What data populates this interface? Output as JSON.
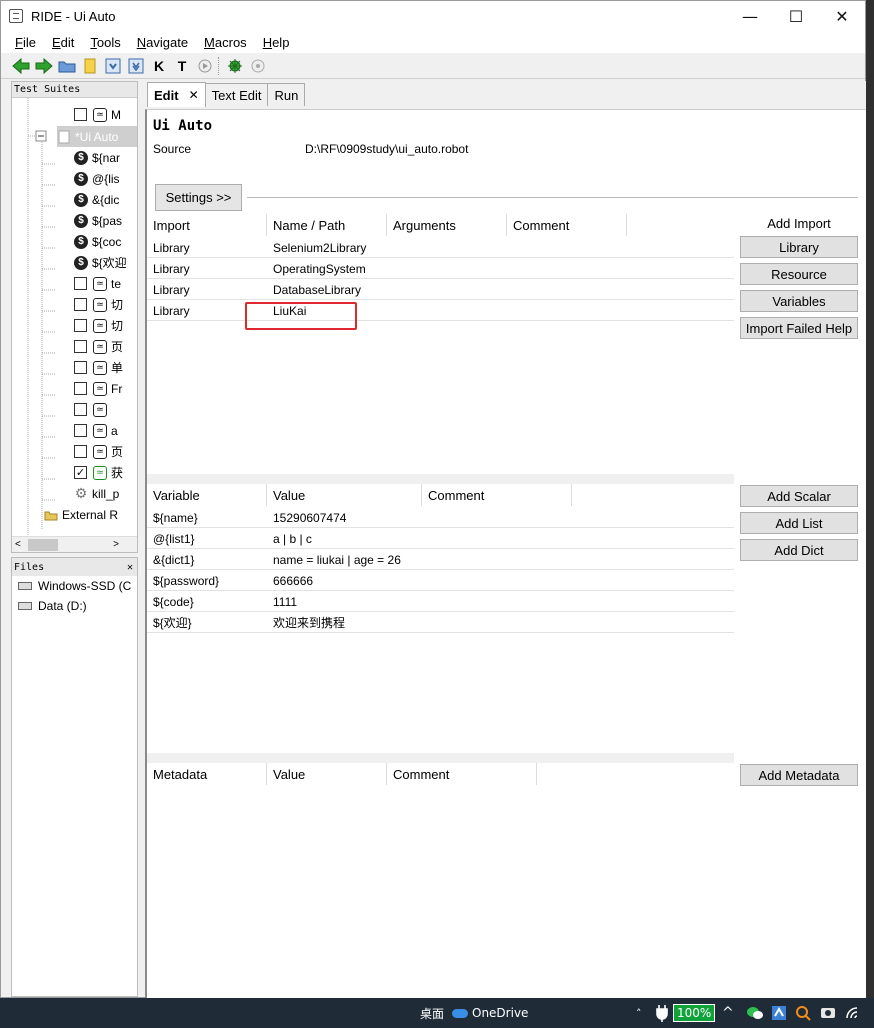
{
  "window": {
    "title": "RIDE - Ui Auto",
    "minimize": "—",
    "maximize": "☐",
    "close": "✕"
  },
  "menu": [
    {
      "key": "F",
      "rest": "ile"
    },
    {
      "key": "E",
      "rest": "dit"
    },
    {
      "key": "T",
      "rest": "ools"
    },
    {
      "key": "N",
      "rest": "avigate"
    },
    {
      "key": "M",
      "rest": "acros"
    },
    {
      "key": "H",
      "rest": "elp"
    }
  ],
  "left": {
    "header": "Test Suites",
    "tree": [
      {
        "kind": "tc",
        "label": "M",
        "checked": false
      },
      {
        "kind": "suite",
        "label": "*Ui Auto"
      },
      {
        "kind": "var",
        "label": "${nar"
      },
      {
        "kind": "var",
        "label": "@{lis"
      },
      {
        "kind": "var",
        "label": "&{dic"
      },
      {
        "kind": "var",
        "label": "${pas"
      },
      {
        "kind": "var",
        "label": "${coc"
      },
      {
        "kind": "var",
        "label": "${欢迎"
      },
      {
        "kind": "tc",
        "label": "te",
        "checked": false
      },
      {
        "kind": "tc",
        "label": "切",
        "checked": false
      },
      {
        "kind": "tc",
        "label": "切",
        "checked": false
      },
      {
        "kind": "tc",
        "label": "页",
        "checked": false
      },
      {
        "kind": "tc",
        "label": "单",
        "checked": false
      },
      {
        "kind": "tc",
        "label": "Fr",
        "checked": false
      },
      {
        "kind": "tc",
        "label": "",
        "checked": false
      },
      {
        "kind": "tc",
        "label": "a",
        "checked": false
      },
      {
        "kind": "tc",
        "label": "页",
        "checked": false
      },
      {
        "kind": "tc-ok",
        "label": "获",
        "checked": true
      },
      {
        "kind": "kw",
        "label": "kill_p"
      },
      {
        "kind": "ext",
        "label": "External R"
      }
    ],
    "scroll_left": "<",
    "scroll_right": ">"
  },
  "files": {
    "header": "Files",
    "close": "✕",
    "drives": [
      "Windows-SSD (C",
      "Data (D:)"
    ]
  },
  "tabs": [
    {
      "label": "Edit",
      "close": "✕"
    },
    {
      "label": "Text Edit"
    },
    {
      "label": "Run"
    }
  ],
  "editor": {
    "suite_name": "Ui Auto",
    "source_label": "Source",
    "source_value": "D:\\RF\\0909study\\ui_auto.robot",
    "settings_button": "Settings >>",
    "imports": {
      "headers": [
        "Import",
        "Name / Path",
        "Arguments",
        "Comment"
      ],
      "rows": [
        [
          "Library",
          "Selenium2Library",
          "",
          ""
        ],
        [
          "Library",
          "OperatingSystem",
          "",
          ""
        ],
        [
          "Library",
          "DatabaseLibrary",
          "",
          ""
        ],
        [
          "Library",
          "LiuKai",
          "",
          ""
        ]
      ],
      "side_label": "Add Import",
      "buttons": [
        "Library",
        "Resource",
        "Variables",
        "Import Failed Help"
      ]
    },
    "variables": {
      "headers": [
        "Variable",
        "Value",
        "Comment"
      ],
      "rows": [
        [
          "${name}",
          "15290607474",
          ""
        ],
        [
          "@{list1}",
          "a | b | c",
          ""
        ],
        [
          "&{dict1}",
          "name = liukai | age = 26",
          ""
        ],
        [
          "${password}",
          "666666",
          ""
        ],
        [
          "${code}",
          "1111",
          ""
        ],
        [
          "${欢迎}",
          "欢迎来到携程",
          ""
        ]
      ],
      "buttons": [
        "Add Scalar",
        "Add List",
        "Add Dict"
      ]
    },
    "metadata": {
      "headers": [
        "Metadata",
        "Value",
        "Comment"
      ],
      "button": "Add Metadata"
    }
  },
  "taskbar": {
    "desktop": "桌面",
    "onedrive": "OneDrive",
    "battery": "100%"
  }
}
